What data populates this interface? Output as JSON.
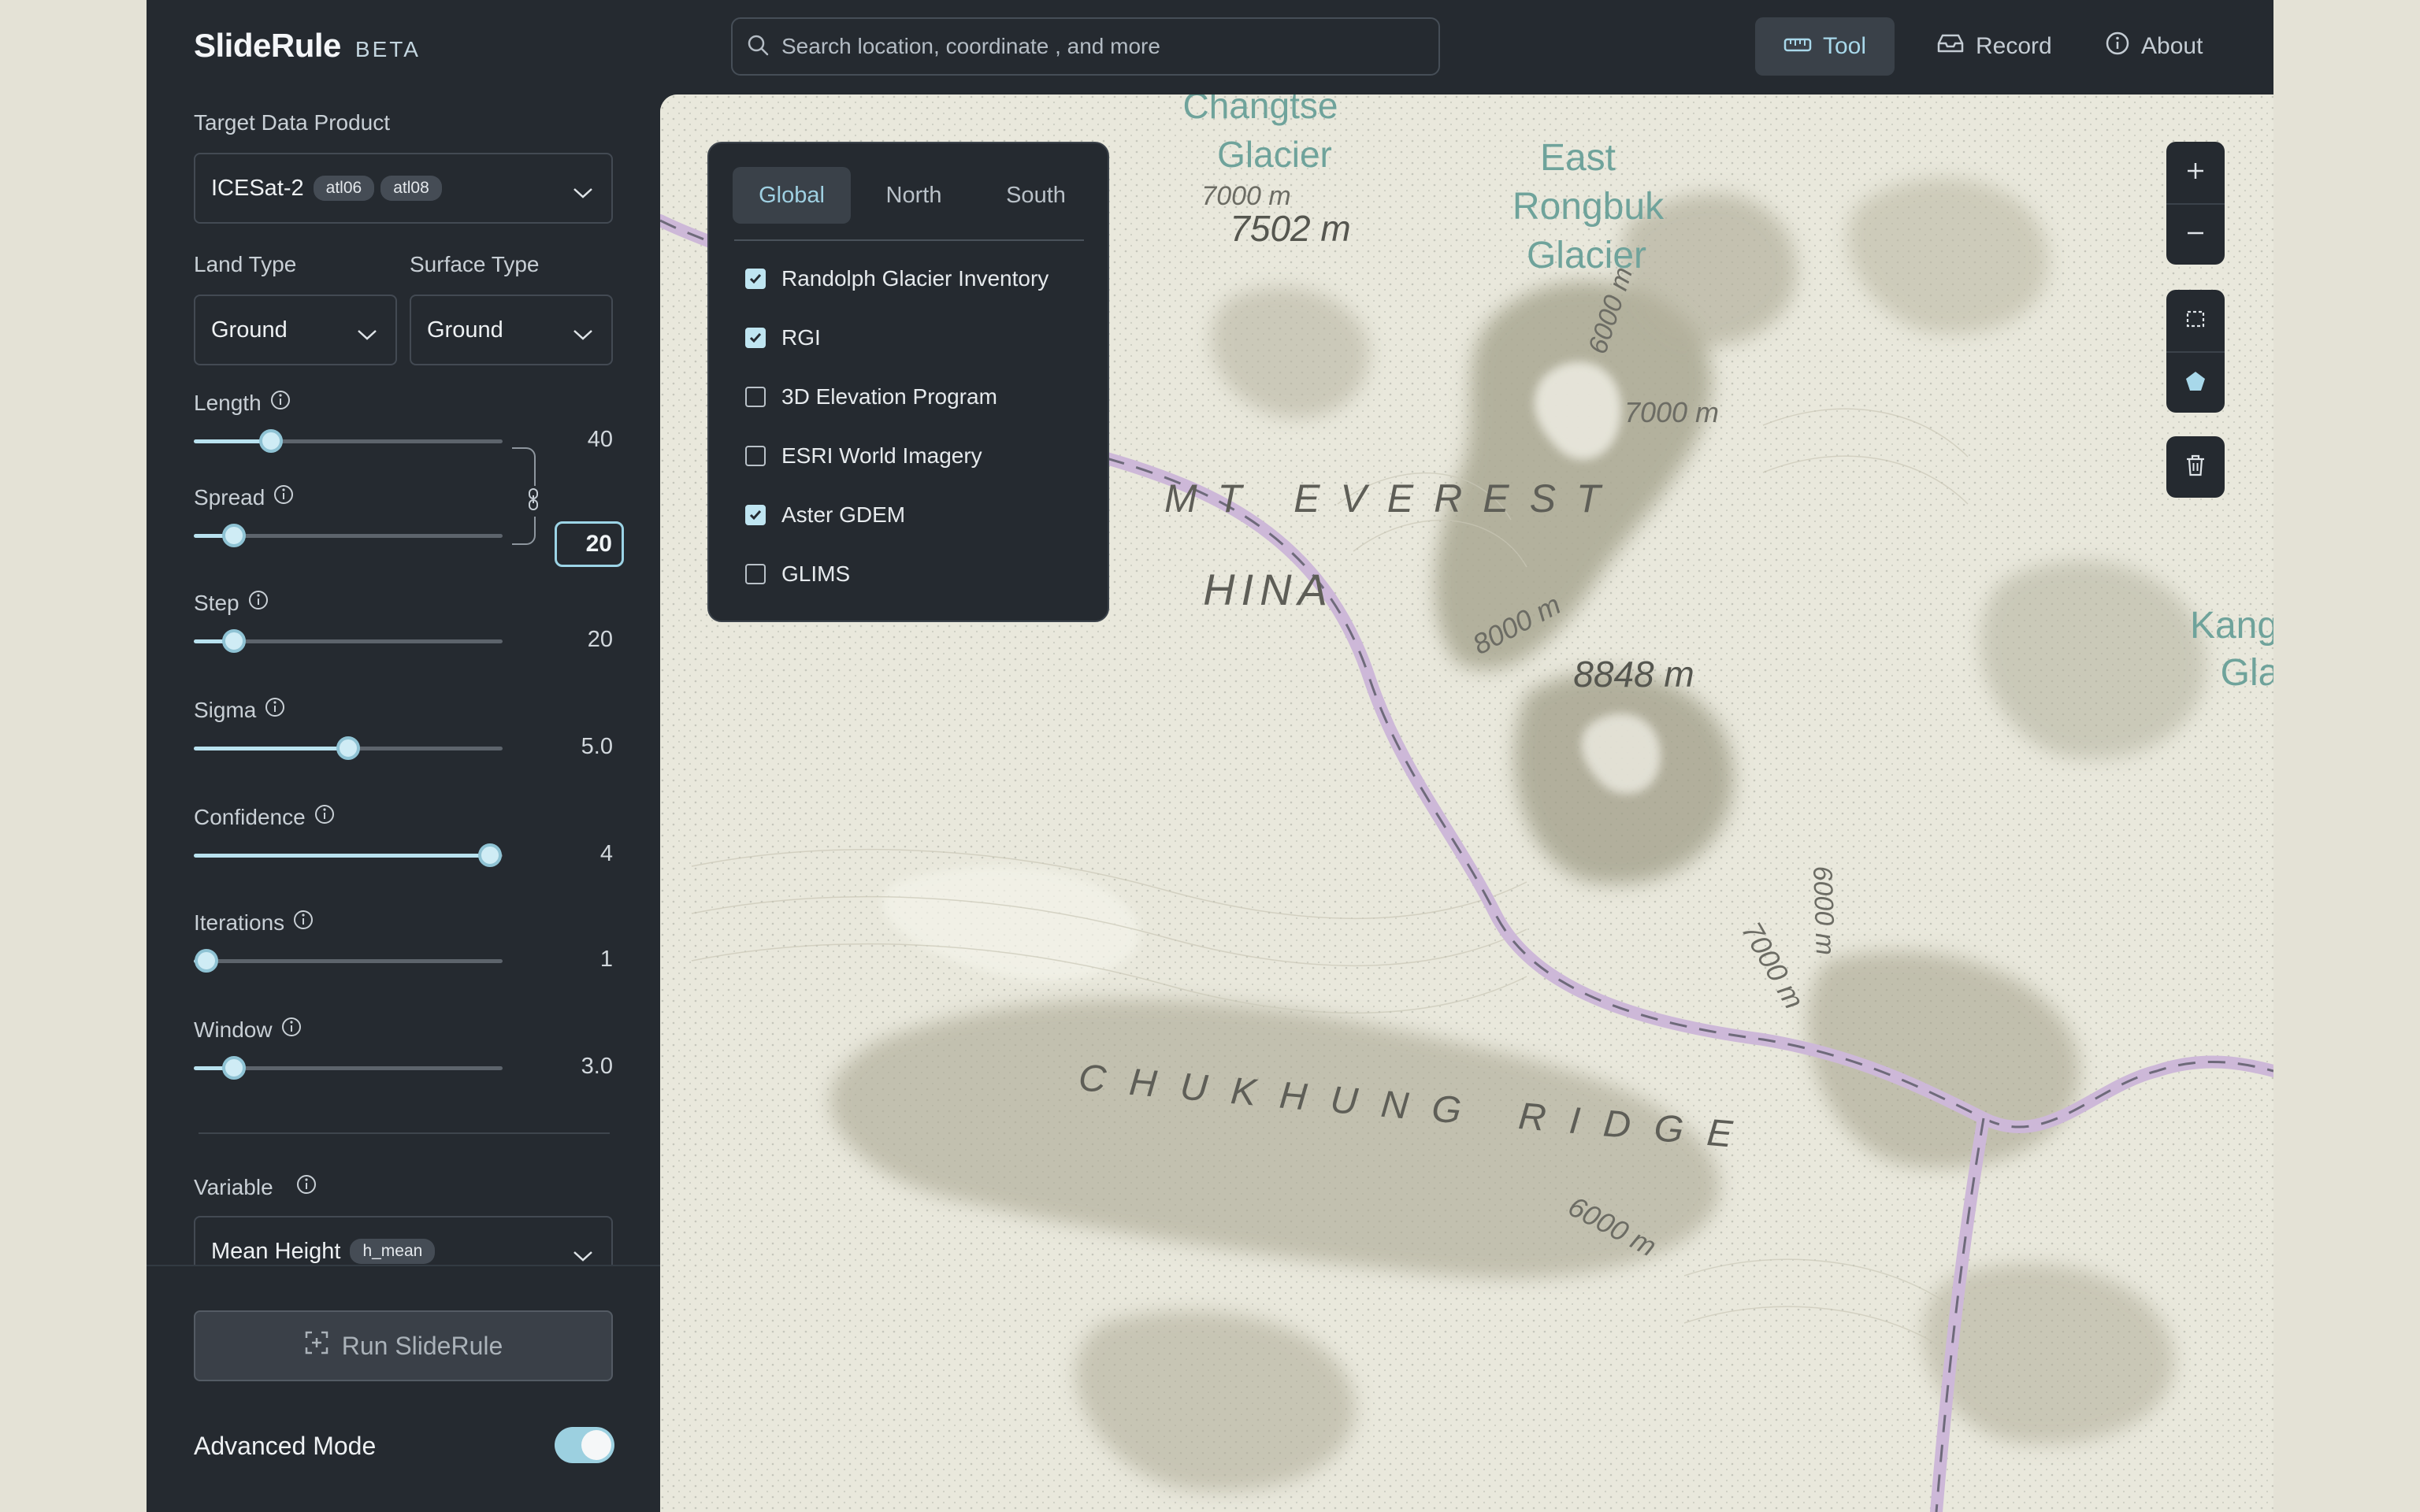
{
  "app": {
    "name": "SlideRule",
    "tag": "BETA"
  },
  "header": {
    "search_placeholder": "Search location, coordinate , and more",
    "nav": [
      {
        "label": "Tool",
        "icon": "ruler-icon",
        "active": true
      },
      {
        "label": "Record",
        "icon": "inbox-icon",
        "active": false
      },
      {
        "label": "About",
        "icon": "info-icon",
        "active": false
      }
    ]
  },
  "sidebar": {
    "target_label": "Target Data Product",
    "target_value": "ICESat-2",
    "target_pills": [
      "atl06",
      "atl08"
    ],
    "land_type_label": "Land Type",
    "land_type_value": "Ground",
    "surface_type_label": "Surface Type",
    "surface_type_value": "Ground",
    "sliders": [
      {
        "label": "Length",
        "value": "40",
        "fraction": 0.25
      },
      {
        "label": "Spread",
        "value": "20",
        "fraction": 0.13
      },
      {
        "label": "Step",
        "value": "20",
        "fraction": 0.13
      },
      {
        "label": "Sigma",
        "value": "5.0",
        "fraction": 0.5
      },
      {
        "label": "Confidence",
        "value": "4",
        "fraction": 0.96
      },
      {
        "label": "Iterations",
        "value": "1",
        "fraction": 0.04
      },
      {
        "label": "Window",
        "value": "3.0",
        "fraction": 0.13
      }
    ],
    "variable_label": "Variable",
    "variable_value": "Mean Height",
    "variable_pill": "h_mean",
    "run_label": "Run SlideRule",
    "advanced_label": "Advanced Mode",
    "advanced_on": true
  },
  "layers": {
    "tabs": [
      "Global",
      "North",
      "South"
    ],
    "active_tab": "Global",
    "items": [
      {
        "label": "Randolph Glacier Inventory",
        "checked": true
      },
      {
        "label": "RGI",
        "checked": true
      },
      {
        "label": "3D Elevation Program",
        "checked": false
      },
      {
        "label": "ESRI World Imagery",
        "checked": false
      },
      {
        "label": "Aster GDEM",
        "checked": true
      },
      {
        "label": "GLIMS",
        "checked": false
      }
    ]
  },
  "map": {
    "labels": {
      "changtse_1": "Changtse",
      "changtse_2": "Glacier",
      "elev_7000_top": "7000 m",
      "elev_7502": "7502 m",
      "east_1": "East",
      "east_2": "Rongbuk",
      "east_3": "Glacier",
      "elev_7000_mid": "7000 m",
      "elev_6000_right": "6000 m",
      "everest": "MT EVEREST",
      "china": "HINA",
      "elev_8000": "8000 m",
      "elev_8848": "8848 m",
      "kang_1": "Kangs",
      "kang_2": "Gla",
      "elev_7000_low": "7000 m",
      "elev_6000_low": "6000 m",
      "ridge": "CHUKHUNG RIDGE",
      "elev_6000_ridge": "6000 m"
    },
    "controls": [
      "zoom-in-icon",
      "zoom-out-icon",
      "rectangle-select-icon",
      "polygon-draw-icon",
      "trash-icon"
    ]
  },
  "colors": {
    "accent": "#a8d8ea",
    "panel": "#252a30",
    "map_base": "#e7e6da",
    "border_line": "#cdb8d8"
  }
}
